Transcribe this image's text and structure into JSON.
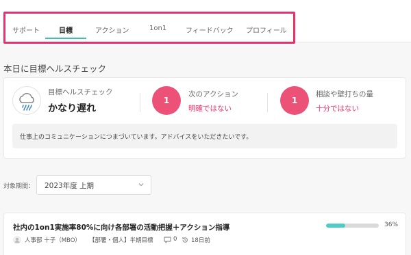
{
  "tabs": [
    {
      "label": "サポート"
    },
    {
      "label": "目標"
    },
    {
      "label": "アクション"
    },
    {
      "label": "1on1"
    },
    {
      "label": "フィードバック"
    },
    {
      "label": "プロフィール"
    }
  ],
  "health": {
    "section_title": "本日に目標ヘルスチェック",
    "goal_label": "目標ヘルスチェック",
    "goal_value": "かなり遅れ",
    "weather_icon": "cloud-rain-icon",
    "next_action_count": "1",
    "next_action_label": "次のアクション",
    "next_action_status": "明確ではない",
    "consult_count": "1",
    "consult_label": "相談や壁打ちの量",
    "consult_status": "十分ではない",
    "advice": "仕事上のコミュニケーションにつまづいています。アドバイスをいただきたいです。",
    "accent_color": "#ec5277"
  },
  "filter": {
    "period_label": "対象期間：",
    "period_value": "2023年度 上期"
  },
  "goal": {
    "title": "社内の1on1実施率80%に向け各部署の活動把握＋アクション指導",
    "progress": 0.36,
    "progress_text": "36%",
    "owner": "人事部 十子（MBO）",
    "type": "【部署・個人】半期目標",
    "comments": "0",
    "updated": "18日前",
    "progress_color": "#4ecdc4"
  }
}
